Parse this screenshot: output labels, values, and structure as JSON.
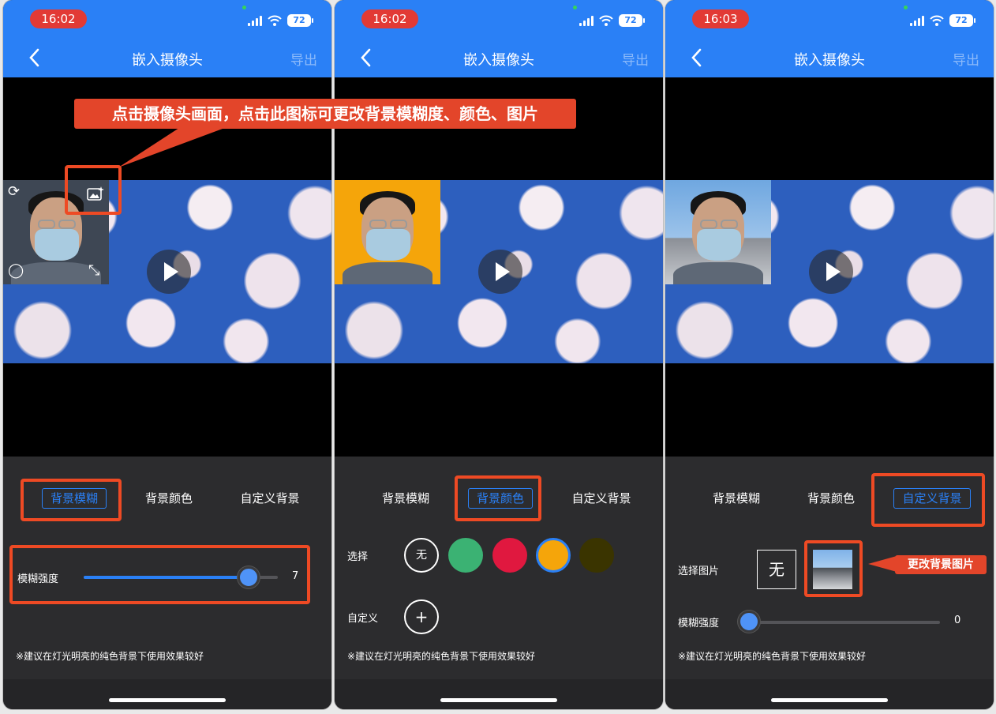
{
  "screens": [
    {
      "status": {
        "time": "16:02",
        "battery": "72"
      },
      "nav": {
        "title": "嵌入摄像头",
        "export": "导出"
      },
      "tabs": [
        "背景模糊",
        "背景颜色",
        "自定义背景"
      ],
      "active_tab": 0,
      "blur": {
        "label": "模糊强度",
        "value": "7",
        "level_fraction": 0.85
      },
      "tip": "※建议在灯光明亮的纯色背景下使用效果较好"
    },
    {
      "status": {
        "time": "16:02",
        "battery": "72"
      },
      "nav": {
        "title": "嵌入摄像头",
        "export": "导出"
      },
      "tabs": [
        "背景模糊",
        "背景颜色",
        "自定义背景"
      ],
      "active_tab": 1,
      "select_label": "选择",
      "none_label": "无",
      "colors": [
        "#3bb273",
        "#e0183f",
        "#f5a50a",
        "#3a3400"
      ],
      "selected_color": "#f5a50a",
      "custom_label": "自定义",
      "add_label": "+",
      "tip": "※建议在灯光明亮的纯色背景下使用效果较好"
    },
    {
      "status": {
        "time": "16:03",
        "battery": "72"
      },
      "nav": {
        "title": "嵌入摄像头",
        "export": "导出"
      },
      "tabs": [
        "背景模糊",
        "背景颜色",
        "自定义背景"
      ],
      "active_tab": 2,
      "select_image_label": "选择图片",
      "none_label": "无",
      "blur": {
        "label": "模糊强度",
        "value": "0",
        "level_fraction": 0.0
      },
      "tip": "※建议在灯光明亮的纯色背景下使用效果较好"
    }
  ],
  "annotations": {
    "main_callout": "点击摄像头画面，点击此图标可更改背景模糊度、颜色、图片",
    "image_callout": "更改背景图片",
    "highlight_color": "#ee4a24"
  },
  "theme": {
    "accent": "#2a80f6",
    "panel": "#2c2c2e"
  }
}
